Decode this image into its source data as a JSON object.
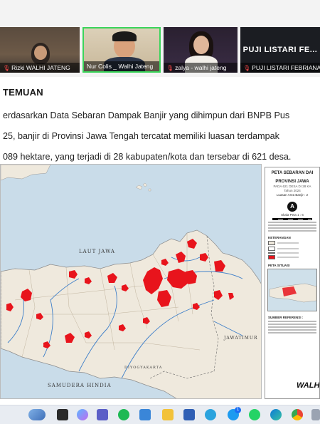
{
  "participants": [
    {
      "name": "Rizki WALHI JATENG",
      "muted": true
    },
    {
      "name": "Nur Colis _ Walhi Jateng",
      "muted": true,
      "active_speaker": true
    },
    {
      "name": "zalya - walhi jateng",
      "muted": true
    },
    {
      "name": "PUJI LISTARI FEBRIANA",
      "muted": true,
      "display_name": "PUJI LISTARI FE..."
    }
  ],
  "slide": {
    "section_title": "TEMUAN",
    "paragraph_lines": [
      "erdasarkan Data Sebaran Dampak Banjir yang dihimpun dari BNPB Pus",
      "25, banjir di Provinsi Jawa Tengah tercatat memiliki luasan terdampak",
      "089 hektare, yang terjadi di 28 kabupaten/kota dan tersebar di 621 desa."
    ],
    "map": {
      "sea_labels": [
        "LAUT JAWA",
        "SAMUDERA HINDIA"
      ],
      "region_labels": [
        "JAWATIMUR",
        "DIYOGYAKARTA"
      ],
      "legend": {
        "title": "PETA SEBARAN DAI",
        "title2": "PROVINSI JAWA",
        "subtitle": "PADA 621 DESA DI 28 KA",
        "year": "Tahun 2024",
        "area_label": "Luasan Area Banjir : 2",
        "north": "A",
        "scale_label": "Skala Peta 1 : 6",
        "legend_heading": "KETERANGAN",
        "inset_heading": "PETA SITUASI",
        "reference_heading": "SUMBER REFERENSI :",
        "logo": "WALH"
      }
    }
  },
  "colors": {
    "flood": "#e8141c",
    "land": "#efe9dd",
    "sea": "#c9dce9",
    "river": "#3e7fc9",
    "active_border": "#3bd45a"
  },
  "taskbar_icons": [
    "weather-icon",
    "taskview-icon",
    "copilot-icon",
    "teams-icon",
    "spotify-icon",
    "store-icon",
    "explorer-icon",
    "app-icon",
    "telegram-icon",
    "twitter-icon",
    "whatsapp-icon",
    "edge-icon",
    "chrome-icon",
    "more-icon"
  ],
  "twitter_badge": "1"
}
